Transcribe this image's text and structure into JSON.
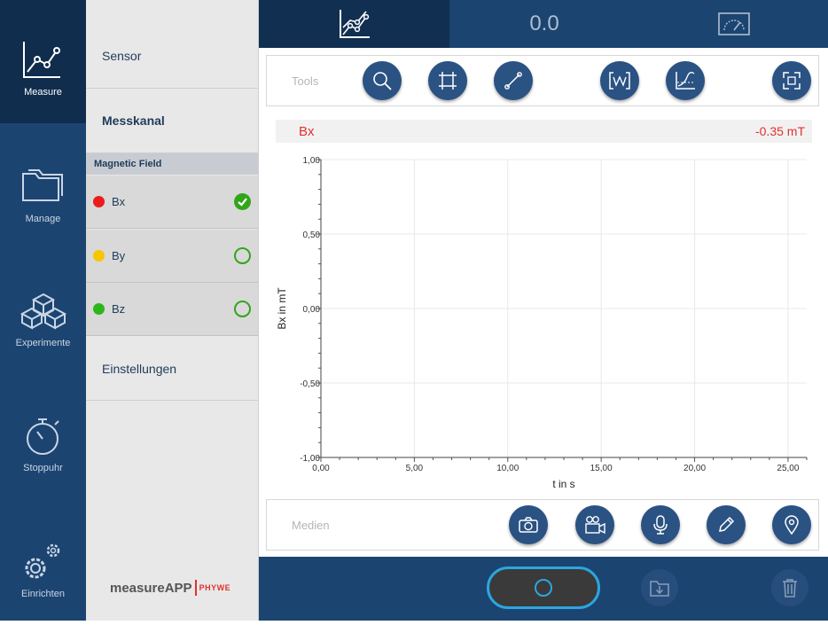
{
  "nav": {
    "items": [
      {
        "label": "Measure",
        "icon": "line-chart-icon"
      },
      {
        "label": "Manage",
        "icon": "folder-icon"
      },
      {
        "label": "Experimente",
        "icon": "cubes-icon"
      },
      {
        "label": "Stoppuhr",
        "icon": "stopwatch-icon"
      },
      {
        "label": "Einrichten",
        "icon": "gears-icon"
      }
    ]
  },
  "side": {
    "sensor_label": "Sensor",
    "channel_label": "Messkanal",
    "group_header": "Magnetic Field",
    "channels": [
      {
        "name": "Bx",
        "color": "#ec1c1c",
        "checked": true
      },
      {
        "name": "By",
        "color": "#f7c600",
        "checked": false
      },
      {
        "name": "Bz",
        "color": "#2fb51c",
        "checked": false
      }
    ],
    "settings_label": "Einstellungen",
    "logo_text": "measureAPP",
    "logo_brand": "PHYWE"
  },
  "tabs": {
    "value_tab": "0.0"
  },
  "tools": {
    "label": "Tools"
  },
  "readout": {
    "channel": "Bx",
    "value": "-0.35 mT"
  },
  "media": {
    "label": "Medien"
  },
  "colors": {
    "nav_bg": "#1c4470",
    "accent_red": "#e0322d",
    "record_ring": "#2ba6e0",
    "button_blue": "#2a5283"
  },
  "chart_data": {
    "type": "line",
    "xlabel": "t in s",
    "ylabel": "Bx in mT",
    "xlim": [
      0,
      26
    ],
    "ylim": [
      -1,
      1
    ],
    "x_ticks": [
      "0,00",
      "5,00",
      "10,00",
      "15,00",
      "20,00",
      "25,00"
    ],
    "y_ticks": [
      "1,00",
      "0,50",
      "0,00",
      "-0,50",
      "-1,00"
    ],
    "series": [],
    "grid": true
  }
}
